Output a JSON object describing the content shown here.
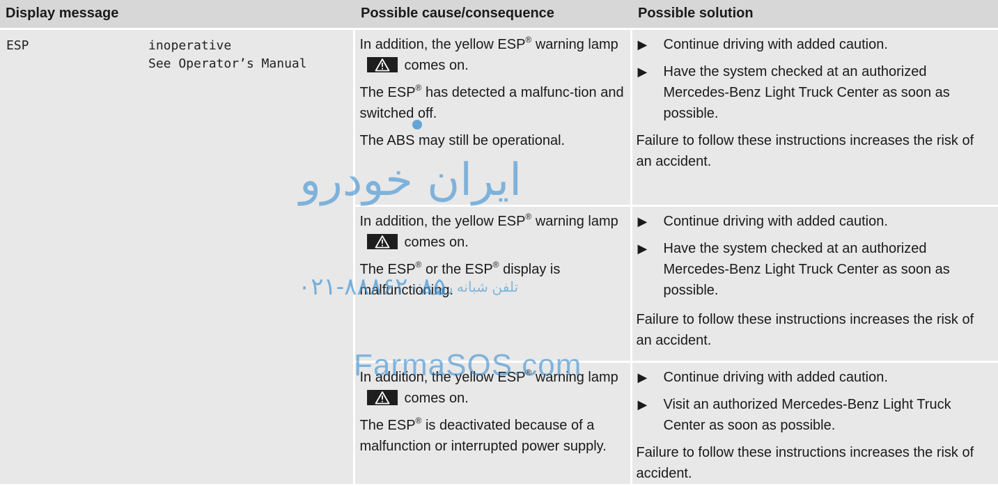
{
  "table": {
    "headers": {
      "display_message": "Display message",
      "cause": "Possible cause/consequence",
      "solution": "Possible solution"
    },
    "message": {
      "code": "ESP",
      "line1": "inoperative",
      "line2": "See Operator’s Manual"
    },
    "rows": [
      {
        "cause": {
          "lamp_pre": "In addition, the yellow ESP",
          "lamp_mid": " warning lamp",
          "lamp_post": "comes on.",
          "p2_pre": "The ESP",
          "p2_post": " has detected a malfunc-tion and switched off.",
          "p3": "The ABS may still be operational."
        },
        "solution": {
          "bullets": [
            "Continue driving with added caution.",
            "Have the system checked at an authorized Mercedes-Benz Light Truck Center as soon as possible."
          ],
          "warning": "Failure to follow these instructions increases the risk of an accident."
        }
      },
      {
        "cause": {
          "lamp_pre": "In addition, the yellow ESP",
          "lamp_mid": " warning lamp",
          "lamp_post": "comes on.",
          "p2_pre": "The ESP",
          "p2_mid": " or the ESP",
          "p2_post": " display is malfunctioning."
        },
        "solution": {
          "bullets": [
            "Continue driving with added caution.",
            "Have the system checked at an authorized Mercedes-Benz Light Truck Center as soon as possible."
          ],
          "warning": "Failure to follow these instructions increases the risk of an accident."
        }
      },
      {
        "cause": {
          "lamp_pre": "In addition, the yellow ESP",
          "lamp_mid": " warning lamp",
          "lamp_post": "comes on.",
          "p2_pre": "The ESP",
          "p2_post": " is deactivated because of a malfunction or interrupted power supply."
        },
        "solution": {
          "bullets": [
            "Continue driving with added caution.",
            "Visit an authorized Mercedes-Benz Light Truck Center as soon as possible."
          ],
          "warning": "Failure to follow these instructions increases the risk of accident."
        }
      }
    ],
    "registered_mark": "®",
    "bullet_glyph": "▶",
    "lamp_icon": "warning-triangle-icon"
  },
  "watermark": {
    "arabic_name": "ایران خودرو",
    "phone_label": "تلفن شبانه روزی:",
    "phone": "۰۲۱-۸۸۸۶۲۰۸۵",
    "site": "FarmaSOS.com"
  },
  "colors": {
    "header_bg": "#d7d7d7",
    "cell_bg": "#e8e8e8",
    "watermark": "#2a86cf"
  }
}
